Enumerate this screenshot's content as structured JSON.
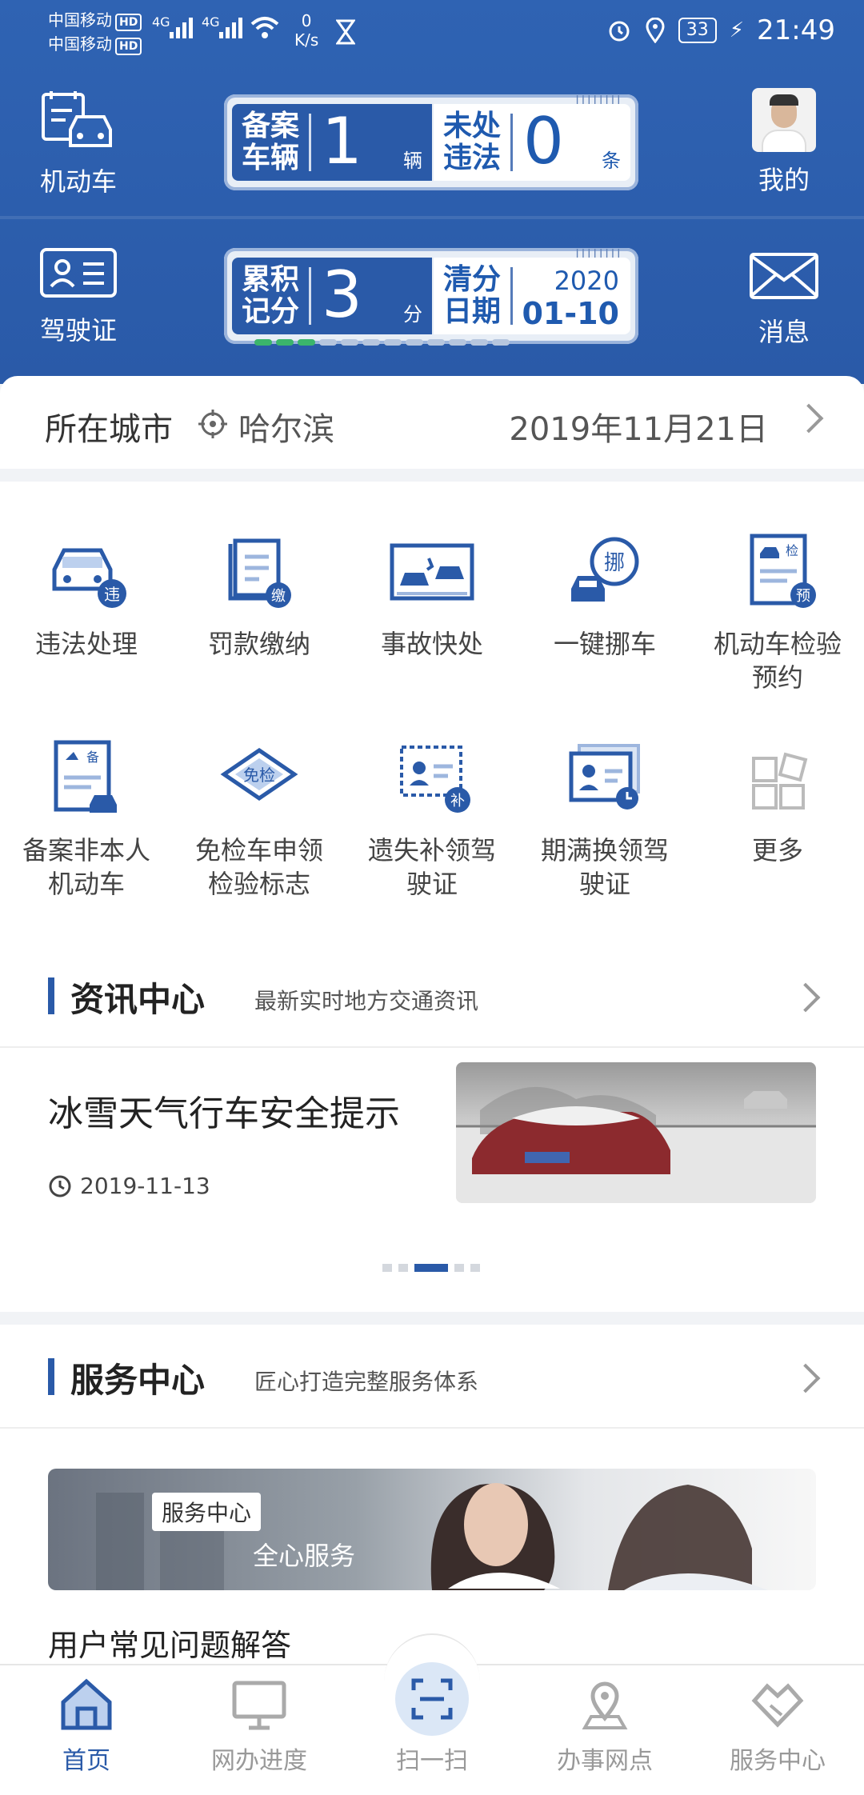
{
  "status_bar": {
    "carrier1": "中国移动",
    "carrier2": "中国移动",
    "hd": "HD",
    "net1": "4G",
    "net2": "4G",
    "speed_value": "0",
    "speed_unit": "K/s",
    "battery": "33",
    "time": "21:49"
  },
  "header": {
    "vehicle_label": "机动车",
    "license_label": "驾驶证",
    "mine_label": "我的",
    "message_label": "消息",
    "card1": {
      "left_key": "备案车辆",
      "left_value": "1",
      "left_unit": "辆",
      "right_key": "未处违法",
      "right_value": "0",
      "right_unit": "条"
    },
    "card2": {
      "left_key": "累积记分",
      "left_value": "3",
      "left_unit": "分",
      "right_key": "清分日期",
      "right_year": "2020",
      "right_date": "01-10",
      "points_progress": 0.25
    }
  },
  "city_row": {
    "label": "所在城市",
    "city": "哈尔滨",
    "date": "2019年11月21日"
  },
  "services": [
    {
      "label": "违法处理",
      "badge": "违",
      "icon": "car-violation-icon"
    },
    {
      "label": "罚款缴纳",
      "badge": "缴",
      "icon": "fine-payment-icon"
    },
    {
      "label": "事故快处",
      "badge": "",
      "icon": "accident-icon"
    },
    {
      "label": "一键挪车",
      "badge": "挪",
      "icon": "move-car-icon"
    },
    {
      "label": "机动车检验预约",
      "badge": "预",
      "icon": "inspection-appointment-icon"
    },
    {
      "label": "备案非本人机动车",
      "badge": "备",
      "icon": "register-vehicle-icon"
    },
    {
      "label": "免检车申领检验标志",
      "badge": "免检",
      "icon": "exempt-inspection-icon"
    },
    {
      "label": "遗失补领驾驶证",
      "badge": "补",
      "icon": "reissue-license-icon"
    },
    {
      "label": "期满换领驾驶证",
      "badge": "",
      "icon": "renew-license-icon"
    },
    {
      "label": "更多",
      "badge": "",
      "icon": "more-icon"
    }
  ],
  "news": {
    "title": "资讯中心",
    "subtitle": "最新实时地方交通资讯",
    "item_title": "冰雪天气行车安全提示",
    "item_date": "2019-11-13",
    "pager_count": 5,
    "pager_active": 2
  },
  "service_center": {
    "title": "服务中心",
    "subtitle": "匠心打造完整服务体系",
    "banner_tag": "服务中心",
    "banner_text": "全心服务",
    "faq_title": "用户常见问题解答"
  },
  "tabbar": {
    "home": "首页",
    "progress": "网办进度",
    "scan": "扫一扫",
    "outlets": "办事网点",
    "service": "服务中心"
  },
  "colors": {
    "primary": "#2a5aa8",
    "green": "#3bb56c"
  }
}
